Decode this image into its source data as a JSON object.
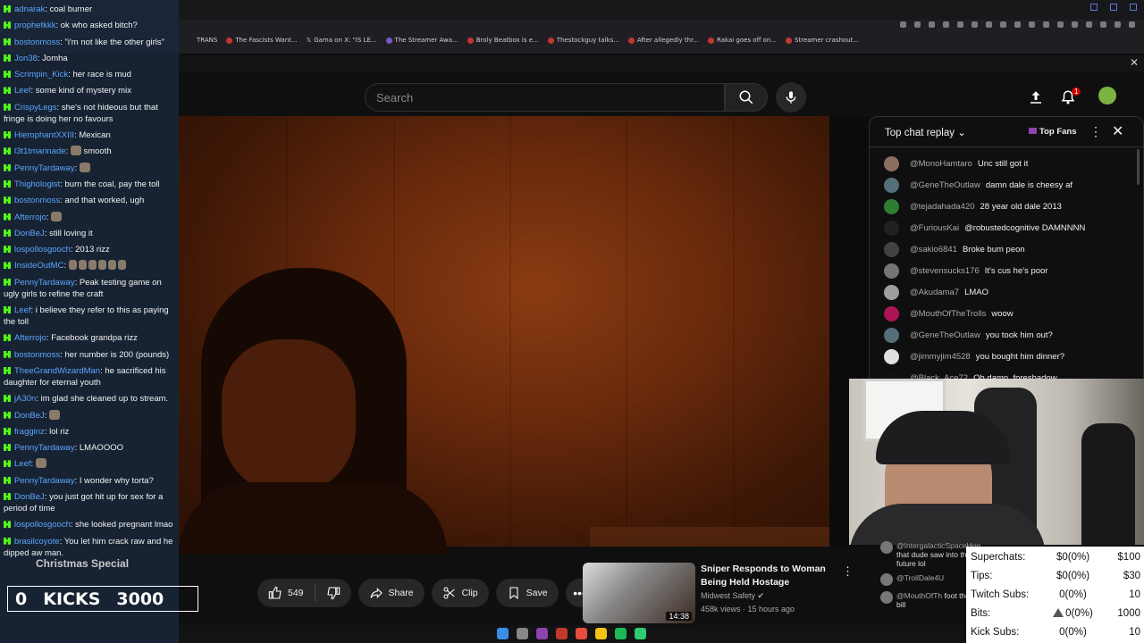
{
  "browser": {
    "bookmarks": [
      "The Fascists Want...",
      "Gama on X: \"IS LE...",
      "The Streamer Awa...",
      "Broly Beatbox is e...",
      "Thestockguy talks...",
      "After allegedly thr...",
      "Rakai goes off on...",
      "Streamer crashout..."
    ],
    "bookmark_trans": "TRANS"
  },
  "youtube": {
    "search_placeholder": "Search",
    "notification_count": "1",
    "actions": {
      "like_count": "549",
      "share": "Share",
      "clip": "Clip",
      "save": "Save"
    }
  },
  "recommendation": {
    "title": "Sniper Responds to Woman Being Held Hostage",
    "channel": "Midwest Safety",
    "meta": "458k views · 15 hours ago",
    "duration": "14:38"
  },
  "live_chat": {
    "title": "Top chat replay",
    "top_fans": "Top Fans",
    "messages": [
      {
        "author": "@MonoHamtaro",
        "text": "Unc still got it",
        "color": "#8d6e63"
      },
      {
        "author": "@GeneTheOutlaw",
        "text": "damn dale is cheesy af",
        "color": "#546e7a"
      },
      {
        "author": "@tejadahada420",
        "text": "28 year old dale 2013",
        "color": "#2e7d32"
      },
      {
        "author": "@FuriousKai",
        "text": "@robustedcognitive DAMNNNN",
        "color": "#212121"
      },
      {
        "author": "@sakio6841",
        "text": "Broke bum peon",
        "color": "#424242"
      },
      {
        "author": "@stevensucks176",
        "text": "It's cus he's poor",
        "color": "#757575"
      },
      {
        "author": "@Akudama7",
        "text": "LMAO",
        "color": "#9e9e9e"
      },
      {
        "author": "@MouthOfTheTrolls",
        "text": "woow",
        "color": "#ad1457"
      },
      {
        "author": "@GeneTheOutlaw",
        "text": "you took him out?",
        "color": "#546e7a"
      },
      {
        "author": "@jimmyjim4528",
        "text": "you bought him dinner?",
        "color": "#e0e0e0"
      },
      {
        "author": "@Black_Ace72",
        "text": "Oh damn, foreshadow",
        "color": "#111111"
      }
    ],
    "partial": [
      {
        "author": "@IntergalacticSpaceHog",
        "text": "that dude saw into the future lol"
      },
      {
        "author": "@TrollDale4U",
        "text": ""
      },
      {
        "author": "@MouthOfTh",
        "text": "foot the bill"
      }
    ]
  },
  "kick_chat": [
    {
      "user": "adnarak",
      "text": "coal burner"
    },
    {
      "user": "prophetkkk",
      "text": "ok who asked bitch?"
    },
    {
      "user": "bostonmoss",
      "text": "\"i'm not like the other girls\""
    },
    {
      "user": "Jon38",
      "text": "Jomha"
    },
    {
      "user": "Scrimpin_Kick",
      "text": "her race is mud"
    },
    {
      "user": "Leef",
      "text": "some kind of mystery mix"
    },
    {
      "user": "CrispyLegs",
      "text": "she's not hideous but that fringe is doing her no favours"
    },
    {
      "user": "HierophantXXIII",
      "text": "Mexican"
    },
    {
      "user": "l3t1tmarinade",
      "text": "smooth",
      "emote": true
    },
    {
      "user": "PennyTardaway",
      "text": "",
      "emote": true
    },
    {
      "user": "Thighologist",
      "text": "burn the coal, pay the toll"
    },
    {
      "user": "bostonmoss",
      "text": "and that worked, ugh"
    },
    {
      "user": "Afterrojo",
      "text": "",
      "emote": true
    },
    {
      "user": "DonBeJ",
      "text": "still loving it"
    },
    {
      "user": "lospollosgooch",
      "text": "2013 rizz"
    },
    {
      "user": "InsideOutMC",
      "text": "",
      "emotes": 6
    },
    {
      "user": "PennyTardaway",
      "text": "Peak testing game on ugly girls to refine the craft"
    },
    {
      "user": "Leef",
      "text": "i believe they refer to this as paying the toll"
    },
    {
      "user": "Afterrojo",
      "text": "Facebook grandpa rizz"
    },
    {
      "user": "bostonmoss",
      "text": "her number is 200 (pounds)"
    },
    {
      "user": "TheeGrandWizardMan",
      "text": "he sacrificed his daughter for eternal youth"
    },
    {
      "user": "jA30n",
      "text": "im glad she cleaned up to stream."
    },
    {
      "user": "DonBeJ",
      "text": "",
      "emote": true
    },
    {
      "user": "fragginz",
      "text": "lol riz"
    },
    {
      "user": "PennyTardaway",
      "text": "LMAOOOO"
    },
    {
      "user": "Leef",
      "text": "",
      "emote": true
    },
    {
      "user": "PennyTardaway",
      "text": "I wonder why torta?"
    },
    {
      "user": "DonBeJ",
      "text": "you just got hit up for sex for a period of time"
    },
    {
      "user": "lospollosgooch",
      "text": "she looked pregnant lmao"
    },
    {
      "user": "brasilcoyote",
      "text": "You let him crack raw and he dipped aw man."
    }
  ],
  "overlay": {
    "kicks_count": "0",
    "kicks_label": "KICKS",
    "kicks_goal": "3000",
    "christmas": "Christmas Special"
  },
  "goals": [
    {
      "label": "Superchats:",
      "value": "$0(0%)",
      "target": "$100"
    },
    {
      "label": "Tips:",
      "value": "$0(0%)",
      "target": "$30"
    },
    {
      "label": "Twitch Subs:",
      "value": "0(0%)",
      "target": "10"
    },
    {
      "label": "Bits:",
      "value": "0(0%)",
      "target": "1000"
    },
    {
      "label": "Kick Subs:",
      "value": "0(0%)",
      "target": "10"
    }
  ]
}
